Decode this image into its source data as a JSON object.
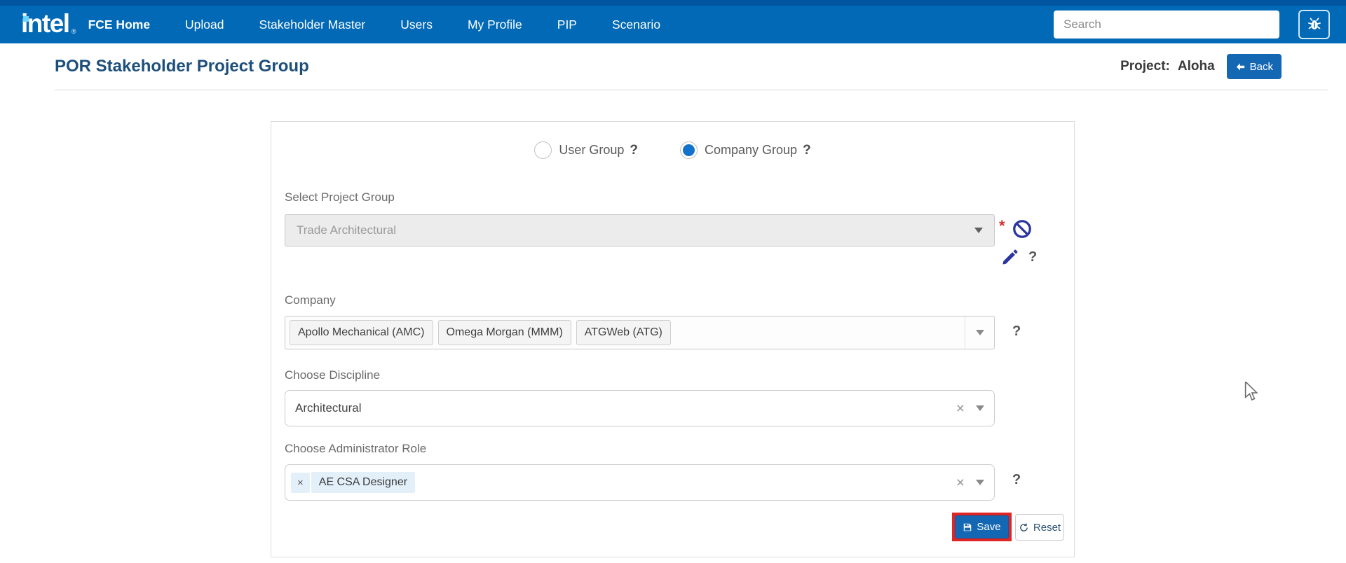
{
  "navbar": {
    "brand": "intel",
    "brand_reg": "®",
    "items": [
      {
        "label": "FCE Home",
        "active": true
      },
      {
        "label": "Upload",
        "active": false
      },
      {
        "label": "Stakeholder Master",
        "active": false
      },
      {
        "label": "Users",
        "active": false
      },
      {
        "label": "My Profile",
        "active": false
      },
      {
        "label": "PIP",
        "active": false
      },
      {
        "label": "Scenario",
        "active": false
      }
    ],
    "search_placeholder": "Search"
  },
  "page": {
    "title": "POR Stakeholder Project Group",
    "project_label": "Project:",
    "project_value": "Aloha",
    "back_label": "Back"
  },
  "form": {
    "help_mark": "?",
    "required_mark": "*",
    "clear_mark": "×",
    "chip_remove_mark": "×",
    "group_type": {
      "options": [
        {
          "label": "User Group",
          "selected": false
        },
        {
          "label": "Company Group",
          "selected": true
        }
      ]
    },
    "project_group": {
      "label": "Select Project Group",
      "value": "Trade Architectural",
      "disabled": true
    },
    "company": {
      "label": "Company",
      "tags": [
        "Apollo Mechanical (AMC)",
        "Omega Morgan (MMM)",
        "ATGWeb (ATG)"
      ]
    },
    "discipline": {
      "label": "Choose Discipline",
      "value": "Architectural"
    },
    "admin_role": {
      "label": "Choose Administrator Role",
      "tags": [
        "AE CSA Designer"
      ]
    },
    "buttons": {
      "save_label": "Save",
      "reset_label": "Reset"
    }
  },
  "colors": {
    "navbar_blue": "#0169B5",
    "navbar_dark_strip": "#0054A0",
    "logo_dot_blue": "#6CD5FF",
    "title_blue": "#1D4F7B",
    "accent_blue": "#1467B3",
    "radio_selected_blue": "#1373CC",
    "icon_navy": "#2B35A0",
    "required_red": "#D32F2F",
    "save_highlight_red": "#E12424",
    "chip_blue_bg": "#E3F0FA",
    "disabled_bg": "#ECECEC"
  }
}
